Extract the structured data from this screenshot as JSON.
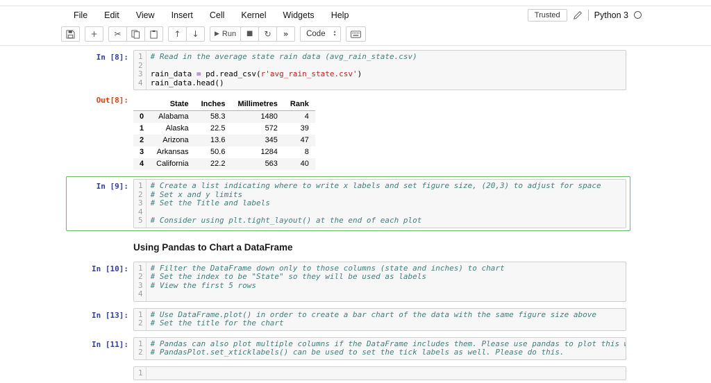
{
  "menubar": {
    "items": [
      "File",
      "Edit",
      "View",
      "Insert",
      "Cell",
      "Kernel",
      "Widgets",
      "Help"
    ],
    "trusted_label": "Trusted",
    "kernel_name": "Python 3"
  },
  "toolbar": {
    "run_label": "Run",
    "cell_type_value": "Code",
    "icons": {
      "add": "+",
      "cut": "✂",
      "move_up": "↑",
      "move_down": "↓",
      "run": "▶",
      "stop": "■",
      "restart": "↻",
      "restart_run_all": "»",
      "select_up": "▴",
      "select_down": "▾"
    }
  },
  "cells": [
    {
      "type": "code",
      "prompt": "In [8]:",
      "selected": false,
      "lines": [
        [
          {
            "t": "com",
            "s": "# Read in the average state rain data (avg_rain_state.csv)"
          }
        ],
        [],
        [
          {
            "t": "n",
            "s": "rain_data "
          },
          {
            "t": "op",
            "s": "="
          },
          {
            "t": "n",
            "s": " pd.read_csv("
          },
          {
            "t": "str",
            "s": "r'avg_rain_state.csv'"
          },
          {
            "t": "n",
            "s": ")"
          }
        ],
        [
          {
            "t": "n",
            "s": "rain_data.head()"
          }
        ]
      ],
      "output": {
        "prompt": "Out[8]:",
        "table": {
          "columns": [
            "State",
            "Inches",
            "Millimetres",
            "Rank"
          ],
          "rows": [
            [
              "0",
              "Alabama",
              "58.3",
              "1480",
              "4"
            ],
            [
              "1",
              "Alaska",
              "22.5",
              "572",
              "39"
            ],
            [
              "2",
              "Arizona",
              "13.6",
              "345",
              "47"
            ],
            [
              "3",
              "Arkansas",
              "50.6",
              "1284",
              "8"
            ],
            [
              "4",
              "California",
              "22.2",
              "563",
              "40"
            ]
          ]
        }
      }
    },
    {
      "type": "code",
      "prompt": "In [9]:",
      "selected": true,
      "lines": [
        [
          {
            "t": "com",
            "s": "# Create a list indicating where to write x labels and set figure size, (20,3) to adjust for space"
          }
        ],
        [
          {
            "t": "com",
            "s": "# Set x and y limits"
          }
        ],
        [
          {
            "t": "com",
            "s": "# Set the Title and labels"
          }
        ],
        [],
        [
          {
            "t": "com",
            "s": "# Consider using plt.tight_layout() at the end of each plot"
          }
        ]
      ]
    },
    {
      "type": "markdown",
      "text": "Using Pandas to Chart a DataFrame"
    },
    {
      "type": "code",
      "prompt": "In [10]:",
      "selected": false,
      "lines": [
        [
          {
            "t": "com",
            "s": "# Filter the DataFrame down only to those columns (state and inches) to chart"
          }
        ],
        [
          {
            "t": "com",
            "s": "# Set the index to be \"State\" so they will be used as labels"
          }
        ],
        [
          {
            "t": "com",
            "s": "# View the first 5 rows"
          }
        ],
        []
      ]
    },
    {
      "type": "code",
      "prompt": "In [13]:",
      "selected": false,
      "lines": [
        [
          {
            "t": "com",
            "s": "# Use DataFrame.plot() in order to create a bar chart of the data with the same figure size above"
          }
        ],
        [
          {
            "t": "com",
            "s": "# Set the title for the chart"
          }
        ]
      ]
    },
    {
      "type": "code",
      "prompt": "In [11]:",
      "selected": false,
      "lines": [
        [
          {
            "t": "com",
            "s": "# Pandas can also plot multiple columns if the DataFrame includes them. Please use pandas to plot this with fig"
          }
        ],
        [
          {
            "t": "com",
            "s": "# PandasPlot.set_xticklabels() can be used to set the tick labels as well. Please do this."
          }
        ]
      ]
    },
    {
      "type": "code",
      "prompt": "",
      "selected": false,
      "lines": [
        []
      ]
    }
  ]
}
